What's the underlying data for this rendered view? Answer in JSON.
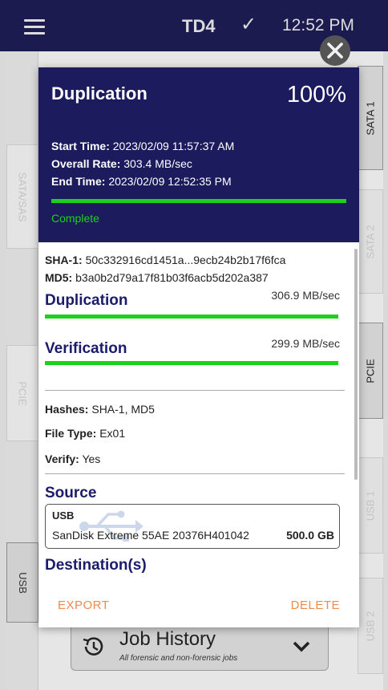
{
  "topbar": {
    "device_name": "TD4",
    "clock": "12:52 PM"
  },
  "left_tabs": [
    "SATA/SAS",
    "PCIE",
    "USB"
  ],
  "right_tabs": [
    "SATA 1",
    "SATA 2",
    "PCIE",
    "USB 1",
    "USB 2"
  ],
  "job_history": {
    "title": "Job History",
    "subtitle": "All forensic and non-forensic jobs"
  },
  "modal": {
    "title": "Duplication",
    "percent": "100%",
    "start_time_label": "Start Time:",
    "start_time": "2023/02/09 11:57:37 AM",
    "overall_rate_label": "Overall Rate:",
    "overall_rate": "303.4 MB/sec",
    "end_time_label": "End Time:",
    "end_time": "2023/02/09 12:52:35 PM",
    "status": "Complete",
    "sha1_label": "SHA-1:",
    "sha1": "50c332916cd1451a...9ecb24b2b17f6fca",
    "md5_label": "MD5:",
    "md5": "b3a0b2d79a17f81b03f6acb5d202a387",
    "duplication_label": "Duplication",
    "duplication_rate": "306.9 MB/sec",
    "verification_label": "Verification",
    "verification_rate": "299.9 MB/sec",
    "hashes_label": "Hashes:",
    "hashes": "SHA-1, MD5",
    "file_type_label": "File Type:",
    "file_type": "Ex01",
    "verify_label": "Verify:",
    "verify": "Yes",
    "source_title": "Source",
    "source_type": "USB",
    "source_name": "SanDisk Extreme 55AE 20376H401042",
    "source_size": "500.0 GB",
    "destinations_title": "Destination(s)",
    "export_label": "EXPORT",
    "delete_label": "DELETE"
  },
  "colors": {
    "header_bg": "#1b1b5e",
    "progress": "#1cd11c",
    "accent_text": "#1b1b6b",
    "footer_action": "#f08a4b"
  }
}
